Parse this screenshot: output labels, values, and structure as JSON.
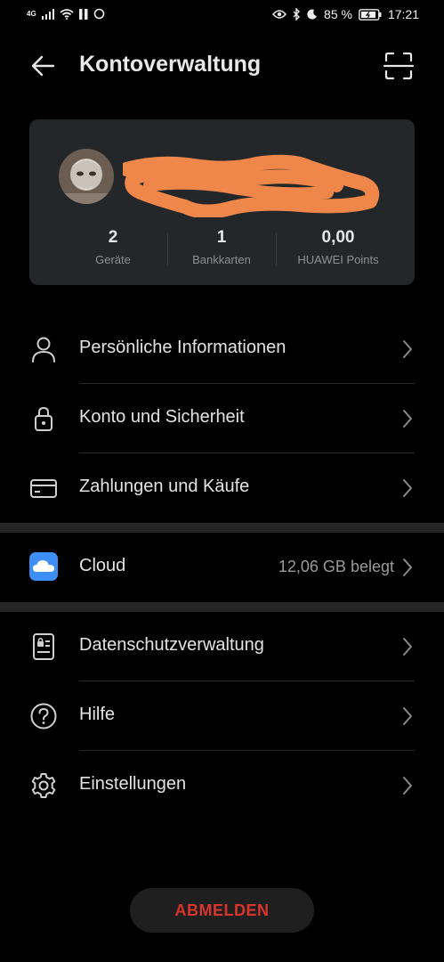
{
  "status_bar": {
    "network": "4G",
    "battery": "85 %",
    "time": "17:21"
  },
  "header": {
    "title": "Kontoverwaltung",
    "back_icon": "back-arrow-icon",
    "scan_icon": "scan-icon"
  },
  "account_card": {
    "stats": [
      {
        "value": "2",
        "label": "Geräte"
      },
      {
        "value": "1",
        "label": "Bankkarten"
      },
      {
        "value": "0,00",
        "label": "HUAWEI Points"
      }
    ]
  },
  "menu": {
    "personal": {
      "label": "Persönliche Informationen",
      "icon": "person-icon"
    },
    "security": {
      "label": "Konto und Sicherheit",
      "icon": "lock-icon"
    },
    "payments": {
      "label": "Zahlungen und Käufe",
      "icon": "card-icon"
    },
    "cloud": {
      "label": "Cloud",
      "value": "12,06 GB belegt",
      "icon": "cloud-icon",
      "color": "#3d8ef5"
    },
    "privacy": {
      "label": "Datenschutzverwaltung",
      "icon": "privacy-icon"
    },
    "help": {
      "label": "Hilfe",
      "icon": "help-icon"
    },
    "settings": {
      "label": "Einstellungen",
      "icon": "gear-icon"
    }
  },
  "logout": {
    "label": "ABMELDEN",
    "color": "#d8352d"
  }
}
